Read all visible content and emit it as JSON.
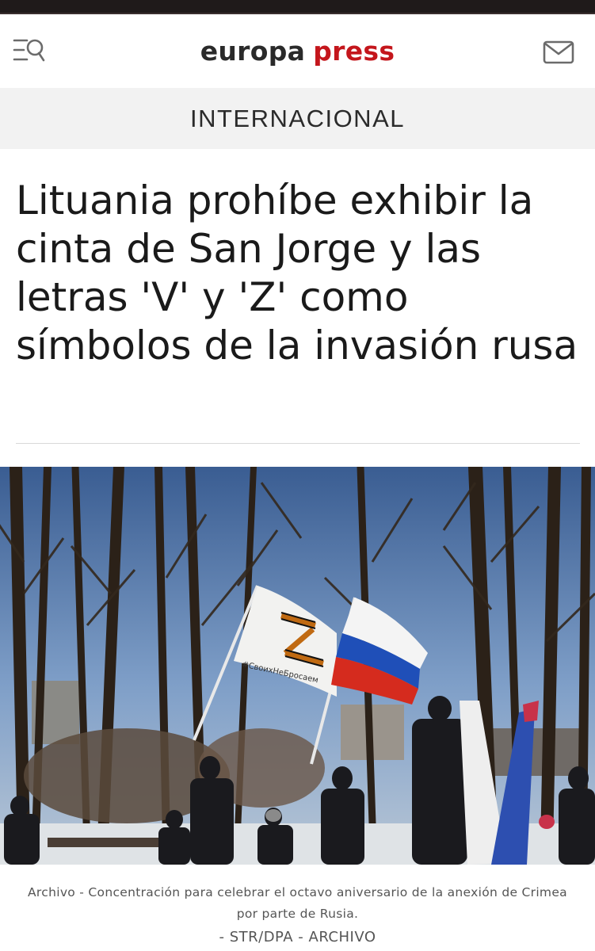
{
  "header": {
    "logo_part1": "europa",
    "logo_part2": "press",
    "menu_icon": "search-menu-icon",
    "mail_icon": "mail-icon",
    "brand_color": "#c4161c"
  },
  "section": {
    "label": "INTERNACIONAL"
  },
  "article": {
    "headline": "Lituania prohíbe exhibir la cinta de San Jorge y las letras 'V' y 'Z' como símbolos de la invasión rusa",
    "photo": {
      "flag_text": "#СвоихНеБросаем"
    },
    "caption": "Archivo - Concentración para celebrar el octavo aniversario de la anexión de Crimea por parte de Rusia.",
    "credit": "- STR/DPA - ARCHIVO"
  }
}
